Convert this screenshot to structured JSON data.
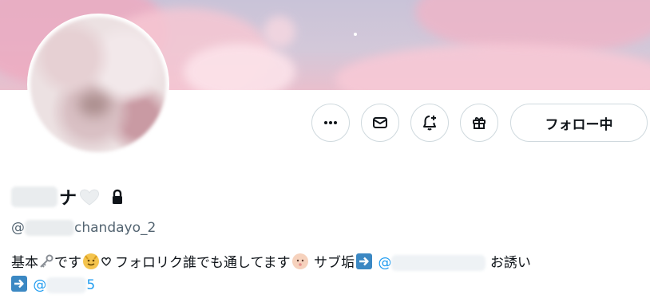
{
  "profile": {
    "follow_label": "フォロー中",
    "name_char": "ナ",
    "handle_prefix": "@",
    "handle_suffix": "chandayo_2"
  },
  "bio": {
    "part1": "基本",
    "part2": "です",
    "part3": "フォロリク誰でも通してます",
    "part4": " サブ垢",
    "mention1_prefix": "@",
    "part5": "お誘い",
    "mention2_prefix": "@",
    "mention2_suffix": "5"
  },
  "icons": {
    "more": "more-icon",
    "message": "mail-icon",
    "notify": "bell-plus-icon",
    "gift": "gift-icon",
    "lock": "lock-icon",
    "heart": "heart-icon",
    "key": "key-icon",
    "arrow": "right-arrow-icon"
  },
  "colors": {
    "accent": "#1d9bf0",
    "text": "#0f1419",
    "secondary": "#536471",
    "border": "#cfd9de",
    "arrow_bg": "#3b88c3"
  }
}
